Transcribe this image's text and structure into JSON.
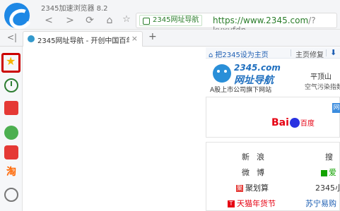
{
  "browser": {
    "title": "2345加速浏览器 8.2",
    "security_badge": "2345网址导航",
    "url": {
      "scheme_host": "https://www.2345.com",
      "path": "/?kyxyfdn"
    },
    "tab": {
      "title": "2345网址导航 - 开创中国百年",
      "close": "×"
    },
    "new_tab": "+",
    "tab_collapse": "<|"
  },
  "sidebar": {
    "items": [
      {
        "name": "favorites",
        "icon": "star-icon"
      },
      {
        "name": "history",
        "icon": "clock-icon"
      },
      {
        "name": "news",
        "icon": "news-icon"
      },
      {
        "name": "chat",
        "icon": "chat-icon"
      },
      {
        "name": "games",
        "icon": "game-icon"
      },
      {
        "name": "taobao",
        "icon": "taobao-icon",
        "label": "淘"
      },
      {
        "name": "gamepad",
        "icon": "gamepad-icon"
      }
    ]
  },
  "page": {
    "utilbar": {
      "set_home": "把2345设为主页",
      "home_fix": "主页修复",
      "desktop_icon": "桌面"
    },
    "logo": {
      "domain": "2345.com",
      "name": "网址导航",
      "tagline": "A股上市公司旗下网站"
    },
    "weather": {
      "city": "平顶山",
      "air": "空气污染指数"
    },
    "search": {
      "engine": "Bai",
      "engine_suffix": "百度",
      "tab_label": "网"
    },
    "links": {
      "sina": "新浪",
      "sou": "搜",
      "weibo": "微博",
      "aiqiyi": "爱",
      "jhs": "聚划算",
      "jhs_mark": "聚",
      "s2345": "2345小",
      "tmall": "天猫年货节",
      "tmall_mark": "T",
      "suning": "苏宁易购"
    }
  },
  "colors": {
    "accent": "#1e88e5",
    "secure_green": "#2a7d2a",
    "highlight_red": "#cc0000"
  }
}
